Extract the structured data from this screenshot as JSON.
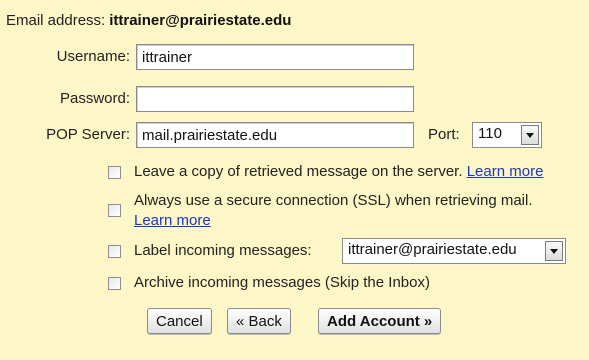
{
  "email": {
    "label": "Email address:",
    "value": "ittrainer@prairiestate.edu"
  },
  "username": {
    "label": "Username:",
    "value": "ittrainer"
  },
  "password": {
    "label": "Password:",
    "value": ""
  },
  "pop": {
    "label": "POP Server:",
    "value": "mail.prairiestate.edu"
  },
  "port": {
    "label": "Port:",
    "value": "110"
  },
  "options": {
    "leave_copy": "Leave a copy of retrieved message on the server.",
    "leave_copy_link": "Learn more",
    "ssl": "Always use a secure connection (SSL) when retrieving mail.",
    "ssl_link": "Learn more",
    "label_incoming": "Label incoming messages:",
    "label_value": "ittrainer@prairiestate.edu",
    "archive": "Archive incoming messages (Skip the Inbox)"
  },
  "buttons": {
    "cancel": "Cancel",
    "back": "« Back",
    "add": "Add Account »"
  }
}
